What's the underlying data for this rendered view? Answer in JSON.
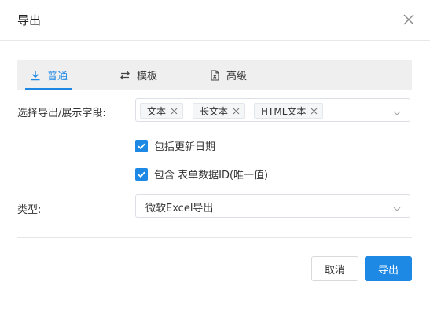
{
  "dialog": {
    "title": "导出"
  },
  "tabs": [
    {
      "label": "普通",
      "icon": "download-icon",
      "active": true
    },
    {
      "label": "模板",
      "icon": "swap-icon",
      "active": false
    },
    {
      "label": "高级",
      "icon": "excel-file-icon",
      "active": false
    }
  ],
  "form": {
    "fields_label": "选择导出/展示字段:",
    "fields_selected": [
      "文本",
      "长文本",
      "HTML文本"
    ],
    "include_update_date": {
      "label": "包括更新日期",
      "checked": true
    },
    "include_form_id": {
      "label": "包含 表单数据ID(唯一值)",
      "checked": true
    },
    "type_label": "类型:",
    "type_value": "微软Excel导出"
  },
  "buttons": {
    "cancel": "取消",
    "ok": "导出"
  },
  "colors": {
    "accent": "#1e88e5",
    "tab_bg": "#efefef"
  }
}
